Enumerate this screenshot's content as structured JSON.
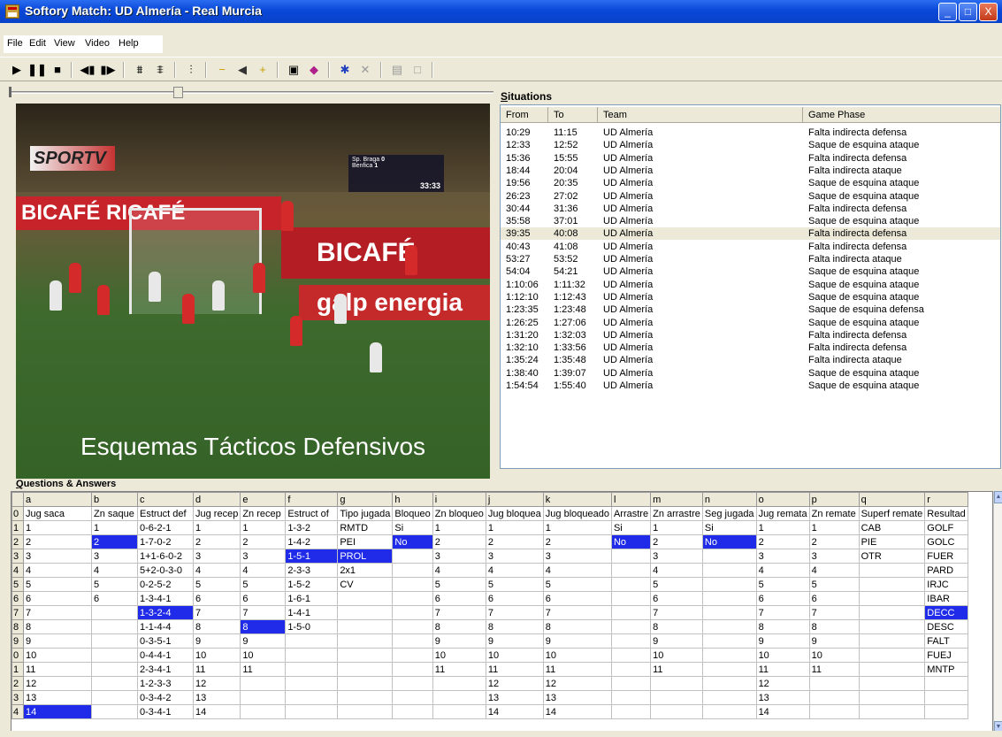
{
  "window": {
    "title": "Softory Match: UD Almería - Real Murcia",
    "minimize": "_",
    "maximize": "□",
    "close": "X"
  },
  "menu": [
    "File",
    "Edit",
    "View",
    "Video",
    "Help"
  ],
  "video": {
    "caption": "Esquemas Tácticos Defensivos",
    "channel_logo": "SPORTV",
    "ad_left": "BICAFÉ   RICAFÉ",
    "ad_right": "BICAFÉ",
    "ad_bottom": "galp energia",
    "score": {
      "home": "Sp. Braga",
      "home_score": "0",
      "away": "Benfica",
      "away_score": "1",
      "clock": "33:33"
    }
  },
  "situations": {
    "label_underlined": "S",
    "label_rest": "ituations",
    "columns": [
      "From",
      "To",
      "Team",
      "Game Phase"
    ],
    "selected_index": 8,
    "rows": [
      [
        "10:29",
        "11:15",
        "UD Almería",
        "Falta indirecta defensa"
      ],
      [
        "12:33",
        "12:52",
        "UD Almería",
        "Saque de esquina ataque"
      ],
      [
        "15:36",
        "15:55",
        "UD Almería",
        "Falta indirecta defensa"
      ],
      [
        "18:44",
        "20:04",
        "UD Almería",
        "Falta indirecta ataque"
      ],
      [
        "19:56",
        "20:35",
        "UD Almería",
        "Saque de esquina ataque"
      ],
      [
        "26:23",
        "27:02",
        "UD Almería",
        "Saque de esquina ataque"
      ],
      [
        "30:44",
        "31:36",
        "UD Almería",
        "Falta indirecta defensa"
      ],
      [
        "35:58",
        "37:01",
        "UD Almería",
        "Saque de esquina ataque"
      ],
      [
        "39:35",
        "40:08",
        "UD Almería",
        "Falta indirecta defensa"
      ],
      [
        "40:43",
        "41:08",
        "UD Almería",
        "Falta indirecta defensa"
      ],
      [
        "53:27",
        "53:52",
        "UD Almería",
        "Falta indirecta ataque"
      ],
      [
        "54:04",
        "54:21",
        "UD Almería",
        "Saque de esquina ataque"
      ],
      [
        "1:10:06",
        "1:11:32",
        "UD Almería",
        "Saque de esquina ataque"
      ],
      [
        "1:12:10",
        "1:12:43",
        "UD Almería",
        "Saque de esquina ataque"
      ],
      [
        "1:23:35",
        "1:23:48",
        "UD Almería",
        "Saque de esquina defensa"
      ],
      [
        "1:26:25",
        "1:27:06",
        "UD Almería",
        "Saque de esquina ataque"
      ],
      [
        "1:31:20",
        "1:32:03",
        "UD Almería",
        "Falta indirecta defensa"
      ],
      [
        "1:32:10",
        "1:33:56",
        "UD Almería",
        "Falta indirecta defensa"
      ],
      [
        "1:35:24",
        "1:35:48",
        "UD Almería",
        "Falta indirecta ataque"
      ],
      [
        "1:38:40",
        "1:39:07",
        "UD Almería",
        "Saque de esquina ataque"
      ],
      [
        "1:54:54",
        "1:55:40",
        "UD Almería",
        "Saque de esquina ataque"
      ]
    ]
  },
  "qa": {
    "label_underlined": "Q",
    "label_rest": "uestions & Answers",
    "col_letters": [
      "a",
      "b",
      "c",
      "d",
      "e",
      "f",
      "g",
      "h",
      "i",
      "j",
      "k",
      "l",
      "m",
      "n",
      "o",
      "p",
      "q",
      "r"
    ],
    "row_labels": [
      "0",
      "1",
      "2",
      "3",
      "4",
      "5",
      "6",
      "7",
      "8",
      "9",
      "0",
      "1",
      "2",
      "3",
      "4"
    ],
    "rows": [
      [
        "Jug saca",
        "Zn saque",
        "Estruct def",
        "Jug recep",
        "Zn recep",
        "Estruct of",
        "Tipo jugada",
        "Bloqueo",
        "Zn bloqueo",
        "Jug bloquea",
        "Jug bloqueado",
        "Arrastre",
        "Zn arrastre",
        "Seg jugada",
        "Jug remata",
        "Zn remate",
        "Superf remate",
        "Resultad"
      ],
      [
        "1",
        "1",
        "0-6-2-1",
        "1",
        "1",
        "1-3-2",
        "RMTD",
        "Si",
        "1",
        "1",
        "1",
        "Si",
        "1",
        "Si",
        "1",
        "1",
        "CAB",
        "GOLF"
      ],
      [
        "2",
        "2",
        "1-7-0-2",
        "2",
        "2",
        "1-4-2",
        "PEI",
        "No",
        "2",
        "2",
        "2",
        "No",
        "2",
        "No",
        "2",
        "2",
        "PIE",
        "GOLC"
      ],
      [
        "3",
        "3",
        "1+1-6-0-2",
        "3",
        "3",
        "1-5-1",
        "PROL",
        "",
        "3",
        "3",
        "3",
        "",
        "3",
        "",
        "3",
        "3",
        "OTR",
        "FUER"
      ],
      [
        "4",
        "4",
        "5+2-0-3-0",
        "4",
        "4",
        "2-3-3",
        "2x1",
        "",
        "4",
        "4",
        "4",
        "",
        "4",
        "",
        "4",
        "4",
        "",
        "PARD"
      ],
      [
        "5",
        "5",
        "0-2-5-2",
        "5",
        "5",
        "1-5-2",
        "CV",
        "",
        "5",
        "5",
        "5",
        "",
        "5",
        "",
        "5",
        "5",
        "",
        "IRJC"
      ],
      [
        "6",
        "6",
        "1-3-4-1",
        "6",
        "6",
        "1-6-1",
        "",
        "",
        "6",
        "6",
        "6",
        "",
        "6",
        "",
        "6",
        "6",
        "",
        "IBAR"
      ],
      [
        "7",
        "",
        "1-3-2-4",
        "7",
        "7",
        "1-4-1",
        "",
        "",
        "7",
        "7",
        "7",
        "",
        "7",
        "",
        "7",
        "7",
        "",
        "DECC"
      ],
      [
        "8",
        "",
        "1-1-4-4",
        "8",
        "8",
        "1-5-0",
        "",
        "",
        "8",
        "8",
        "8",
        "",
        "8",
        "",
        "8",
        "8",
        "",
        "DESC"
      ],
      [
        "9",
        "",
        "0-3-5-1",
        "9",
        "9",
        "",
        "",
        "",
        "9",
        "9",
        "9",
        "",
        "9",
        "",
        "9",
        "9",
        "",
        "FALT"
      ],
      [
        "10",
        "",
        "0-4-4-1",
        "10",
        "10",
        "",
        "",
        "",
        "10",
        "10",
        "10",
        "",
        "10",
        "",
        "10",
        "10",
        "",
        "FUEJ"
      ],
      [
        "11",
        "",
        "2-3-4-1",
        "11",
        "11",
        "",
        "",
        "",
        "11",
        "11",
        "11",
        "",
        "11",
        "",
        "11",
        "11",
        "",
        "MNTP"
      ],
      [
        "12",
        "",
        "1-2-3-3",
        "12",
        "",
        "",
        "",
        "",
        "",
        "12",
        "12",
        "",
        "",
        "",
        "12",
        "",
        "",
        ""
      ],
      [
        "13",
        "",
        "0-3-4-2",
        "13",
        "",
        "",
        "",
        "",
        "",
        "13",
        "13",
        "",
        "",
        "",
        "13",
        "",
        "",
        ""
      ],
      [
        "14",
        "",
        "0-3-4-1",
        "14",
        "",
        "",
        "",
        "",
        "",
        "14",
        "14",
        "",
        "",
        "",
        "14",
        "",
        "",
        ""
      ]
    ],
    "highlighted": [
      "2,1",
      "2,7",
      "2,11",
      "2,13",
      "3,5",
      "3,6",
      "7,2",
      "7,17",
      "8,4",
      "14,0"
    ],
    "highlight_color": "#1f2be8"
  },
  "icons": [
    "play-icon",
    "pause-icon",
    "stop-icon",
    "step-back-icon",
    "step-forward-icon",
    "lineup-icon",
    "lineup-2-icon",
    "formation-icon",
    "zoom-out-icon",
    "volume-icon",
    "zoom-in-icon",
    "save-icon",
    "book-icon",
    "asterisk-icon",
    "delete-icon",
    "properties-icon",
    "window-icon"
  ]
}
